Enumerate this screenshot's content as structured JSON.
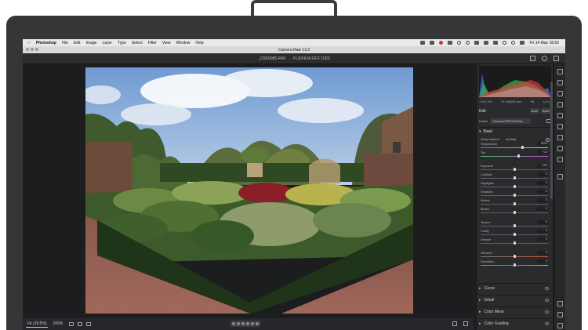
{
  "menubar": {
    "apple": "",
    "app": "Photoshop",
    "items": [
      "File",
      "Edit",
      "Image",
      "Layer",
      "Type",
      "Select",
      "Filter",
      "View",
      "Window",
      "Help"
    ],
    "clock": "Fri 14 May  18:50"
  },
  "window": {
    "title": "Camera Raw 13.2"
  },
  "filebar": {
    "filename": "_DSF0085.RAF",
    "camera": "FUJIFILM GFX 100S"
  },
  "histogram": {
    "exif": [
      "ISO 100",
      "32-64@55 mm",
      "f/8",
      "1/4 s"
    ]
  },
  "edit": {
    "title": "Edit",
    "auto_label": "Auto",
    "bw_label": "B&W",
    "profile_label": "Profile",
    "profile_value": "Camera PROVIA/Sta..."
  },
  "basic": {
    "title": "Basic",
    "white_balance_label": "White balance",
    "white_balance_value": "As Shot",
    "sliders": [
      {
        "label": "Temperature",
        "value": "6000",
        "pos": 0.62,
        "style": "temp"
      },
      {
        "label": "Tint",
        "value": "+12",
        "pos": 0.56,
        "style": "tint"
      },
      {
        "label": "Exposure",
        "value": "0.00",
        "pos": 0.5,
        "style": ""
      },
      {
        "label": "Contrast",
        "value": "0",
        "pos": 0.5,
        "style": ""
      },
      {
        "label": "Highlights",
        "value": "0",
        "pos": 0.5,
        "style": ""
      },
      {
        "label": "Shadows",
        "value": "0",
        "pos": 0.5,
        "style": ""
      },
      {
        "label": "Whites",
        "value": "0",
        "pos": 0.5,
        "style": ""
      },
      {
        "label": "Blacks",
        "value": "0",
        "pos": 0.5,
        "style": ""
      },
      {
        "label": "Texture",
        "value": "0",
        "pos": 0.5,
        "style": ""
      },
      {
        "label": "Clarity",
        "value": "0",
        "pos": 0.5,
        "style": ""
      },
      {
        "label": "Dehaze",
        "value": "0",
        "pos": 0.5,
        "style": ""
      },
      {
        "label": "Vibrance",
        "value": "0",
        "pos": 0.5,
        "style": "vib"
      },
      {
        "label": "Saturation",
        "value": "0",
        "pos": 0.5,
        "style": "sat"
      }
    ]
  },
  "sections": [
    "Curve",
    "Detail",
    "Color Mixer",
    "Color Grading"
  ],
  "bottombar": {
    "fit": "Fit (19.5%)",
    "zoom": "100%"
  },
  "colors": {
    "panel": "#2a2b2d",
    "accent": "#d0342c"
  }
}
